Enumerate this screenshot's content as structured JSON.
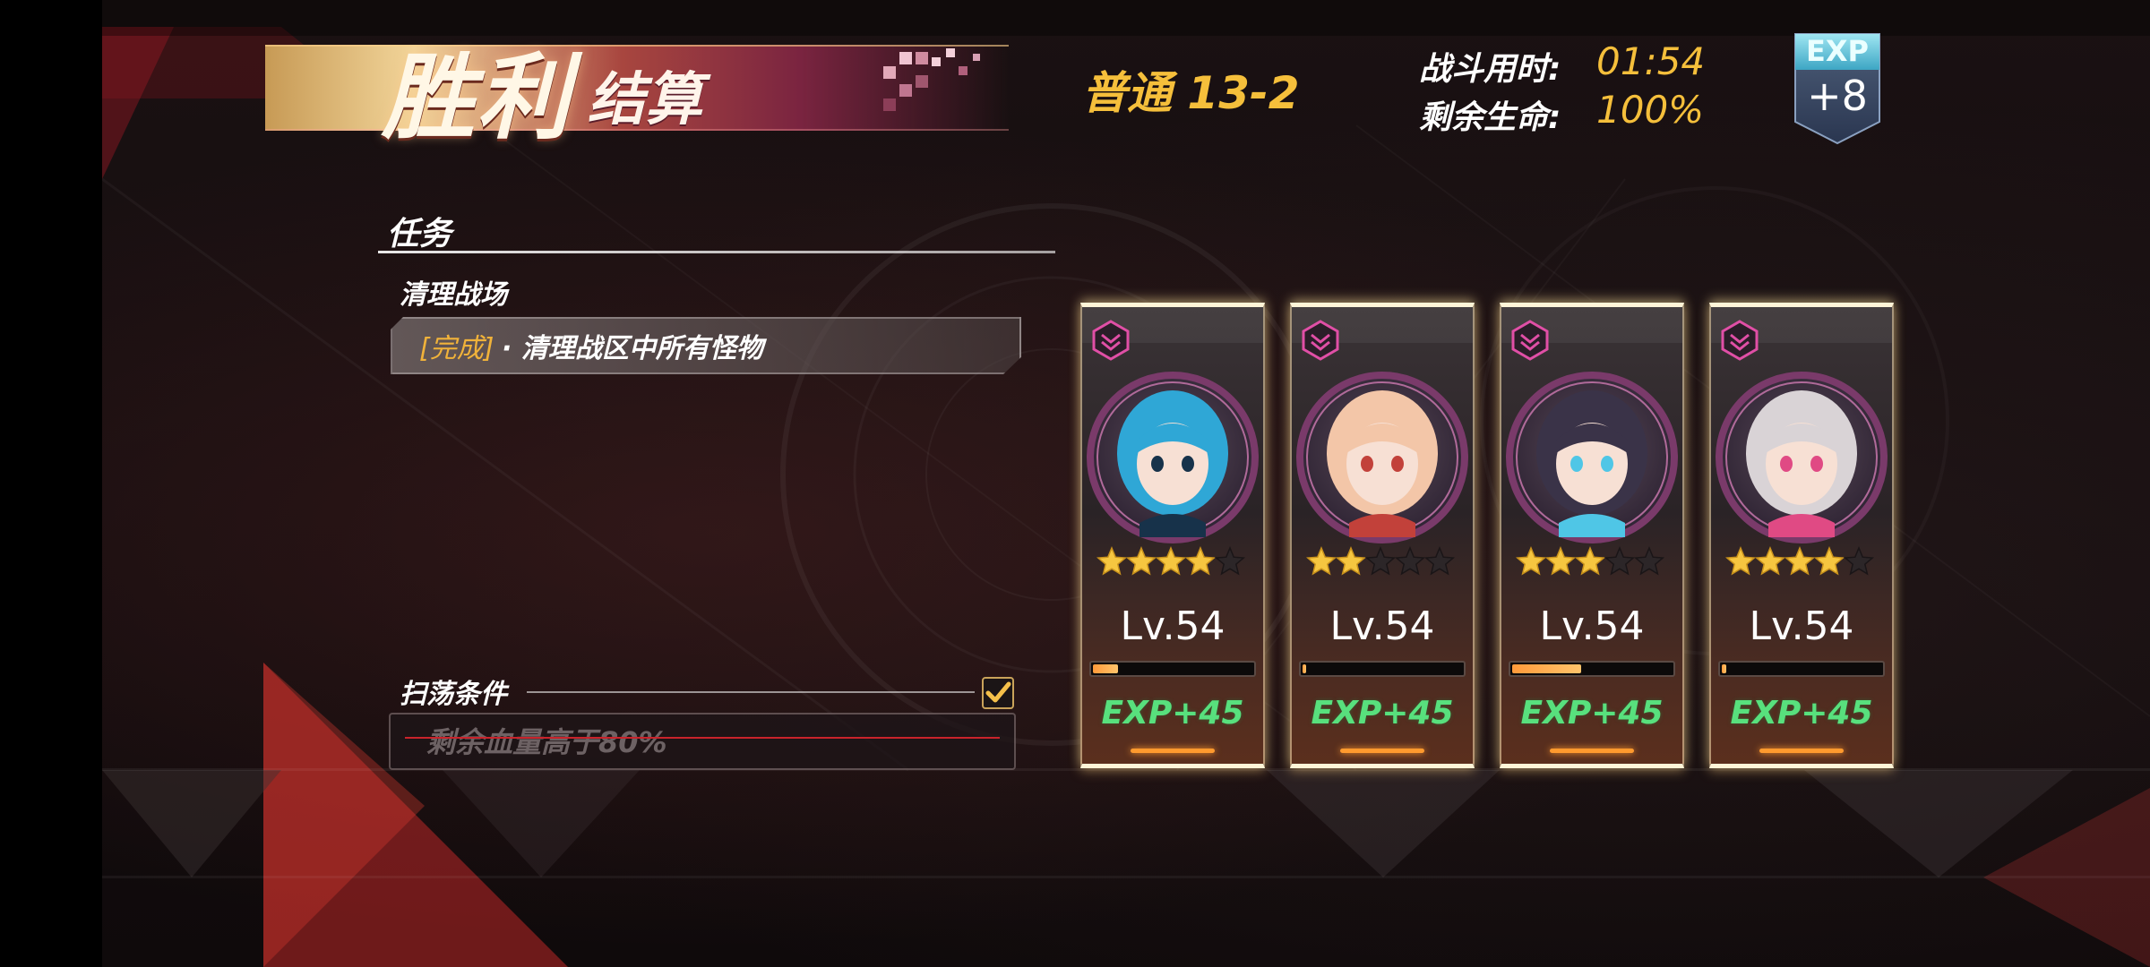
{
  "result": {
    "title_main": "胜利",
    "title_sub": "结算",
    "stage": "普通 13-2",
    "battle_time_label": "战斗用时:",
    "battle_time_value": "01:54",
    "remaining_hp_label": "剩余生命:",
    "remaining_hp_value": "100%",
    "exp_badge_label": "EXP",
    "exp_badge_value": "+8"
  },
  "mission": {
    "header": "任务",
    "name": "清理战场",
    "status": "[完成]",
    "description": "· 清理战区中所有怪物"
  },
  "sweep": {
    "label": "扫荡条件",
    "condition": "剩余血量高于80%",
    "checked": true
  },
  "characters": [
    {
      "stars": 4,
      "max_stars": 5,
      "level": "Lv.54",
      "exp_gain": "EXP+45",
      "exp_progress": 0.16,
      "hair_color": "#2fa7d6",
      "accent": "#17324a"
    },
    {
      "stars": 2,
      "max_stars": 5,
      "level": "Lv.54",
      "exp_gain": "EXP+45",
      "exp_progress": 0.02,
      "hair_color": "#f3c6a8",
      "accent": "#c2413a"
    },
    {
      "stars": 3,
      "max_stars": 5,
      "level": "Lv.54",
      "exp_gain": "EXP+45",
      "exp_progress": 0.43,
      "hair_color": "#3a3348",
      "accent": "#4fc6e6"
    },
    {
      "stars": 4,
      "max_stars": 5,
      "level": "Lv.54",
      "exp_gain": "EXP+45",
      "exp_progress": 0.03,
      "hair_color": "#d9d3d6",
      "accent": "#e04a84"
    }
  ],
  "colors": {
    "gold": "#f5bf3b",
    "exp_green": "#58e07d",
    "card_border": "#fff5d8",
    "rank_pink": "#e04fa6",
    "portrait_ring": "#7a3a6a"
  }
}
